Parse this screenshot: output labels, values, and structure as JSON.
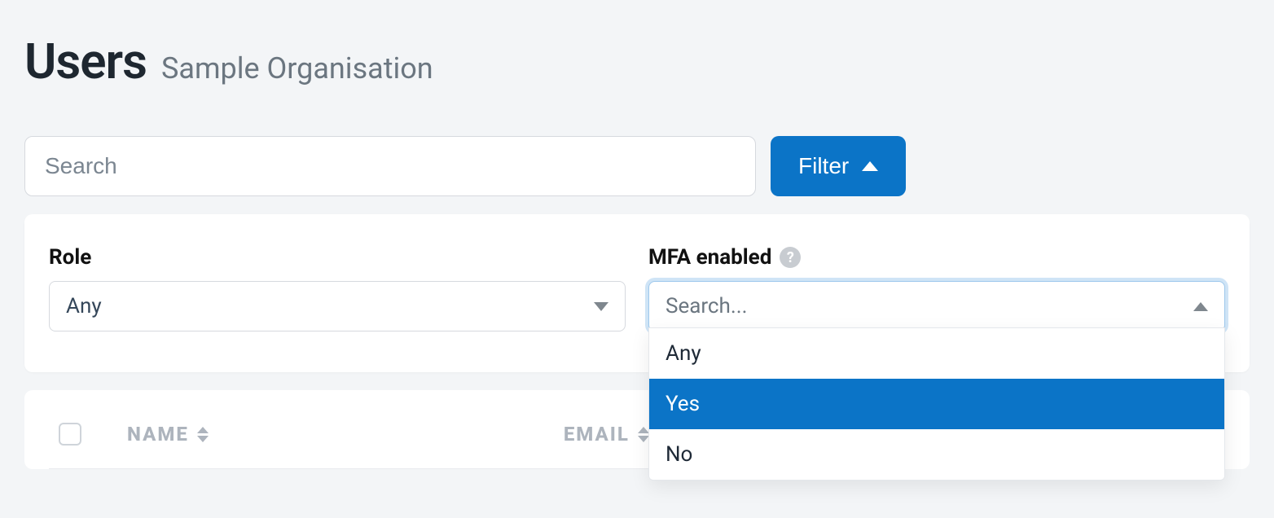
{
  "header": {
    "title": "Users",
    "subtitle": "Sample Organisation"
  },
  "search": {
    "placeholder": "Search",
    "value": ""
  },
  "filter_button": {
    "label": "Filter"
  },
  "filters": {
    "role": {
      "label": "Role",
      "value": "Any"
    },
    "mfa": {
      "label": "MFA enabled",
      "placeholder": "Search...",
      "options": [
        "Any",
        "Yes",
        "No"
      ],
      "highlighted_index": 1
    }
  },
  "table": {
    "columns": {
      "name": "NAME",
      "email": "EMAIL"
    }
  }
}
